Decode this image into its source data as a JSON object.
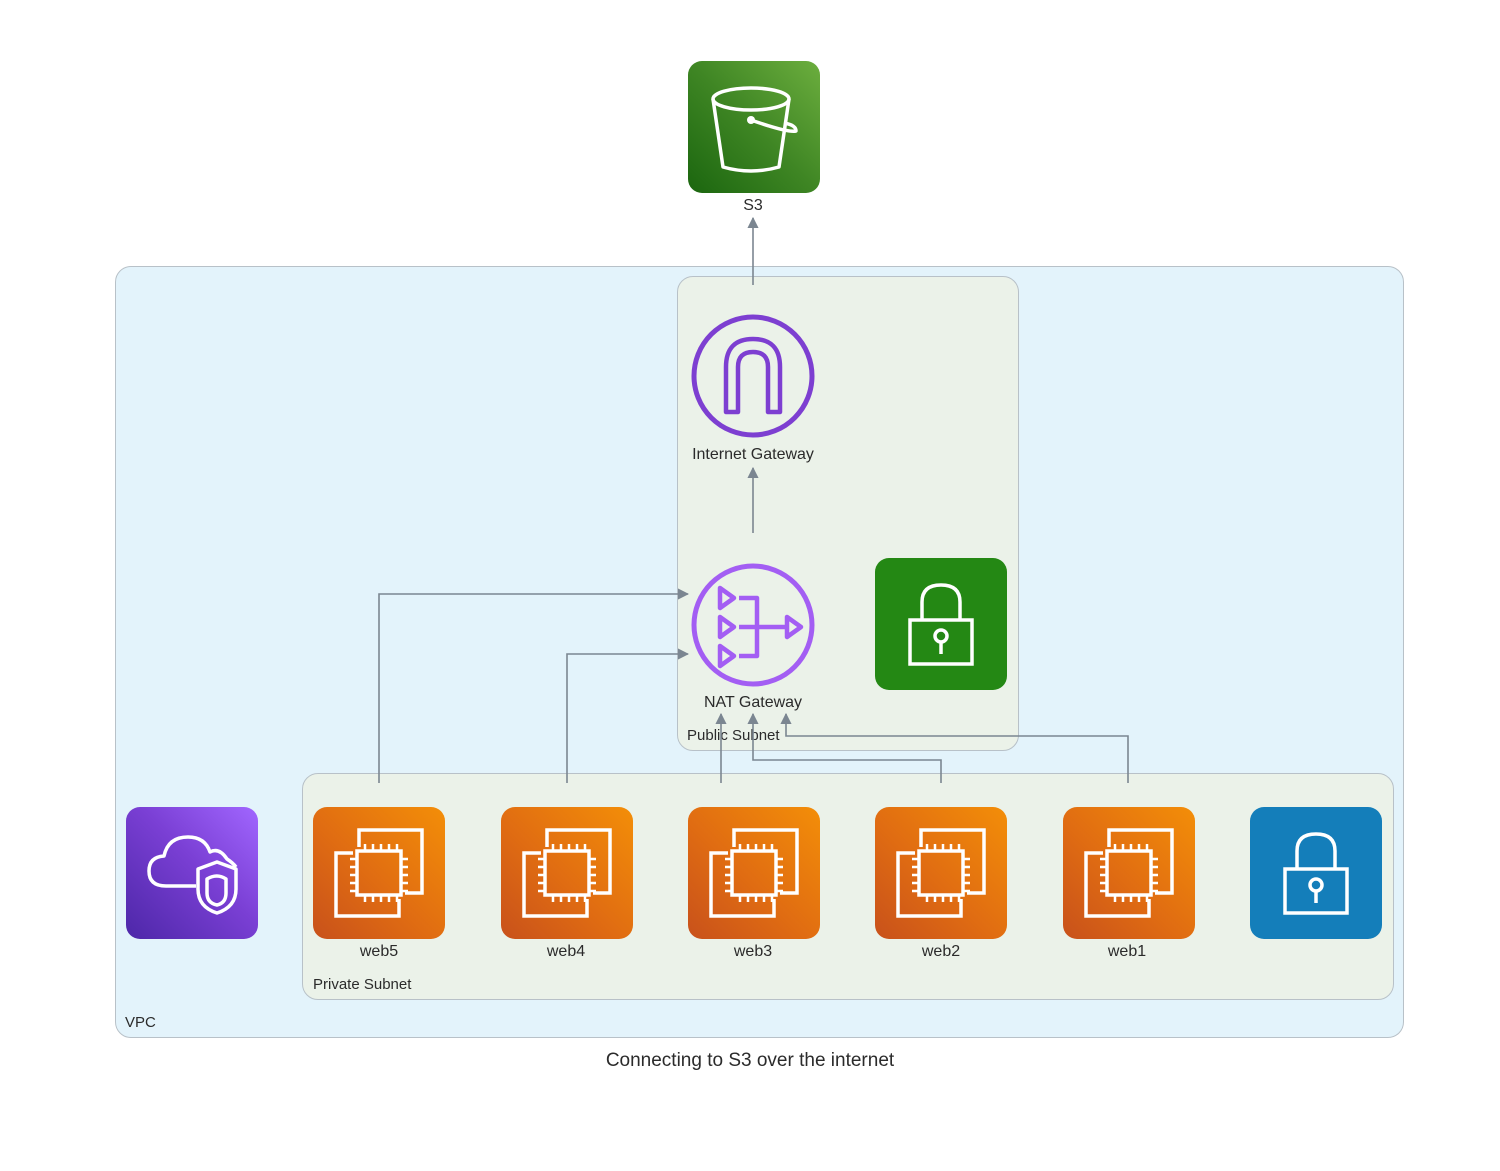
{
  "title": "Connecting to S3 over the internet",
  "clusters": {
    "vpc": "VPC",
    "public_subnet": "Public Subnet",
    "private_subnet": "Private Subnet"
  },
  "nodes": {
    "s3": {
      "label": "S3",
      "icon": "s3-bucket-icon",
      "color": "#3f8624"
    },
    "internet_gateway": {
      "label": "Internet Gateway",
      "icon": "internet-gateway-icon",
      "color": "#7d3fd1"
    },
    "nat_gateway": {
      "label": "NAT Gateway",
      "icon": "nat-gateway-icon",
      "color": "#a35ef3"
    },
    "public_nacl": {
      "label": "",
      "icon": "lock-icon",
      "color": "#248814"
    },
    "private_nacl": {
      "label": "",
      "icon": "lock-icon",
      "color": "#147eba"
    },
    "vpc_security": {
      "label": "",
      "icon": "cloud-shield-icon",
      "color": "#7a3fd4"
    },
    "instances": [
      {
        "label": "web5",
        "icon": "ec2-instances-icon"
      },
      {
        "label": "web4",
        "icon": "ec2-instances-icon"
      },
      {
        "label": "web3",
        "icon": "ec2-instances-icon"
      },
      {
        "label": "web2",
        "icon": "ec2-instances-icon"
      },
      {
        "label": "web1",
        "icon": "ec2-instances-icon"
      }
    ]
  },
  "edges": [
    {
      "from": "web5",
      "to": "NAT Gateway"
    },
    {
      "from": "web4",
      "to": "NAT Gateway"
    },
    {
      "from": "web3",
      "to": "NAT Gateway"
    },
    {
      "from": "web2",
      "to": "NAT Gateway"
    },
    {
      "from": "web1",
      "to": "NAT Gateway"
    },
    {
      "from": "NAT Gateway",
      "to": "Internet Gateway"
    },
    {
      "from": "Internet Gateway",
      "to": "S3"
    }
  ],
  "edge_color": "#7b8691"
}
